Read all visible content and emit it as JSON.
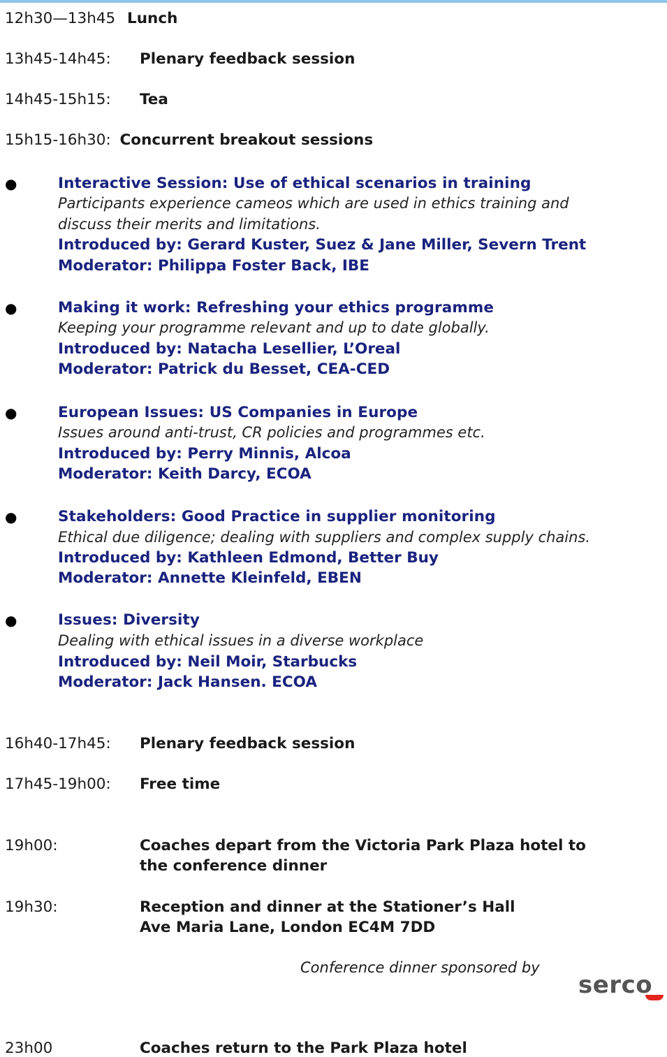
{
  "agenda": [
    {
      "time": "12h30—13h45",
      "title": "Lunch"
    },
    {
      "time": "13h45-14h45:",
      "title": "Plenary feedback session"
    },
    {
      "time": "14h45-15h15:",
      "title": "Tea"
    },
    {
      "time": "15h15-16h30:",
      "title": "Concurrent breakout sessions"
    }
  ],
  "sessions": [
    {
      "title": "Interactive Session: Use of ethical scenarios in training",
      "description": [
        "Participants experience cameos which are used in ethics training and",
        "discuss their merits and limitations."
      ],
      "introduced_by": "Introduced by: Gerard Kuster, Suez & Jane Miller, Severn Trent",
      "moderator": "Moderator: Philippa Foster Back, IBE"
    },
    {
      "title": "Making it work: Refreshing your ethics programme",
      "description": [
        "Keeping your programme relevant and up to date globally."
      ],
      "introduced_by": "Introduced by: Natacha Lesellier, L’Oreal",
      "moderator": "Moderator: Patrick du Besset, CEA-CED"
    },
    {
      "title": "European Issues: US Companies in Europe",
      "description": [
        "Issues around anti-trust, CR policies and programmes etc."
      ],
      "introduced_by": "Introduced by: Perry Minnis, Alcoa",
      "moderator": "Moderator: Keith Darcy, ECOA"
    },
    {
      "title": "Stakeholders: Good Practice in supplier monitoring",
      "description": [
        "Ethical due diligence; dealing with suppliers and complex supply chains."
      ],
      "introduced_by": "Introduced by: Kathleen Edmond, Better Buy",
      "moderator": "Moderator: Annette Kleinfeld, EBEN"
    },
    {
      "title": "Issues: Diversity",
      "description": [
        "Dealing with ethical issues in a diverse workplace"
      ],
      "introduced_by": "Introduced by: Neil Moir, Starbucks",
      "moderator": "Moderator: Jack Hansen. ECOA"
    }
  ],
  "evening": [
    {
      "time": "16h40-17h45:",
      "title": "Plenary feedback session"
    },
    {
      "time": "17h45-19h00:",
      "title": "Free time"
    },
    {
      "time": "19h00:",
      "title_lines": [
        "Coaches depart from the Victoria Park Plaza hotel to",
        "the conference dinner"
      ]
    },
    {
      "time": "19h30:",
      "title_lines": [
        "Reception and dinner at the Stationer’s Hall",
        "Ave Maria Lane, London EC4M 7DD"
      ]
    },
    {
      "time": "23h00",
      "title": "Coaches return to the Park Plaza hotel"
    }
  ],
  "sponsor": {
    "text": "Conference dinner sponsored by",
    "logo_text": "serco",
    "logo_color": "#e3261c"
  },
  "colors": {
    "session_blue": "#1a237e",
    "top_rule": "#8fc5e8"
  }
}
